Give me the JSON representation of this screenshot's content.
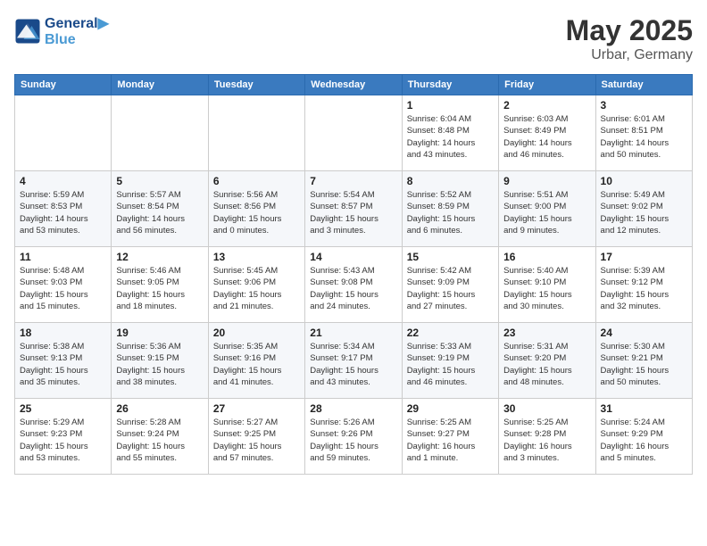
{
  "header": {
    "logo_line1": "General",
    "logo_line2": "Blue",
    "month": "May 2025",
    "location": "Urbar, Germany"
  },
  "weekdays": [
    "Sunday",
    "Monday",
    "Tuesday",
    "Wednesday",
    "Thursday",
    "Friday",
    "Saturday"
  ],
  "weeks": [
    [
      {
        "day": "",
        "info": ""
      },
      {
        "day": "",
        "info": ""
      },
      {
        "day": "",
        "info": ""
      },
      {
        "day": "",
        "info": ""
      },
      {
        "day": "1",
        "info": "Sunrise: 6:04 AM\nSunset: 8:48 PM\nDaylight: 14 hours\nand 43 minutes."
      },
      {
        "day": "2",
        "info": "Sunrise: 6:03 AM\nSunset: 8:49 PM\nDaylight: 14 hours\nand 46 minutes."
      },
      {
        "day": "3",
        "info": "Sunrise: 6:01 AM\nSunset: 8:51 PM\nDaylight: 14 hours\nand 50 minutes."
      }
    ],
    [
      {
        "day": "4",
        "info": "Sunrise: 5:59 AM\nSunset: 8:53 PM\nDaylight: 14 hours\nand 53 minutes."
      },
      {
        "day": "5",
        "info": "Sunrise: 5:57 AM\nSunset: 8:54 PM\nDaylight: 14 hours\nand 56 minutes."
      },
      {
        "day": "6",
        "info": "Sunrise: 5:56 AM\nSunset: 8:56 PM\nDaylight: 15 hours\nand 0 minutes."
      },
      {
        "day": "7",
        "info": "Sunrise: 5:54 AM\nSunset: 8:57 PM\nDaylight: 15 hours\nand 3 minutes."
      },
      {
        "day": "8",
        "info": "Sunrise: 5:52 AM\nSunset: 8:59 PM\nDaylight: 15 hours\nand 6 minutes."
      },
      {
        "day": "9",
        "info": "Sunrise: 5:51 AM\nSunset: 9:00 PM\nDaylight: 15 hours\nand 9 minutes."
      },
      {
        "day": "10",
        "info": "Sunrise: 5:49 AM\nSunset: 9:02 PM\nDaylight: 15 hours\nand 12 minutes."
      }
    ],
    [
      {
        "day": "11",
        "info": "Sunrise: 5:48 AM\nSunset: 9:03 PM\nDaylight: 15 hours\nand 15 minutes."
      },
      {
        "day": "12",
        "info": "Sunrise: 5:46 AM\nSunset: 9:05 PM\nDaylight: 15 hours\nand 18 minutes."
      },
      {
        "day": "13",
        "info": "Sunrise: 5:45 AM\nSunset: 9:06 PM\nDaylight: 15 hours\nand 21 minutes."
      },
      {
        "day": "14",
        "info": "Sunrise: 5:43 AM\nSunset: 9:08 PM\nDaylight: 15 hours\nand 24 minutes."
      },
      {
        "day": "15",
        "info": "Sunrise: 5:42 AM\nSunset: 9:09 PM\nDaylight: 15 hours\nand 27 minutes."
      },
      {
        "day": "16",
        "info": "Sunrise: 5:40 AM\nSunset: 9:10 PM\nDaylight: 15 hours\nand 30 minutes."
      },
      {
        "day": "17",
        "info": "Sunrise: 5:39 AM\nSunset: 9:12 PM\nDaylight: 15 hours\nand 32 minutes."
      }
    ],
    [
      {
        "day": "18",
        "info": "Sunrise: 5:38 AM\nSunset: 9:13 PM\nDaylight: 15 hours\nand 35 minutes."
      },
      {
        "day": "19",
        "info": "Sunrise: 5:36 AM\nSunset: 9:15 PM\nDaylight: 15 hours\nand 38 minutes."
      },
      {
        "day": "20",
        "info": "Sunrise: 5:35 AM\nSunset: 9:16 PM\nDaylight: 15 hours\nand 41 minutes."
      },
      {
        "day": "21",
        "info": "Sunrise: 5:34 AM\nSunset: 9:17 PM\nDaylight: 15 hours\nand 43 minutes."
      },
      {
        "day": "22",
        "info": "Sunrise: 5:33 AM\nSunset: 9:19 PM\nDaylight: 15 hours\nand 46 minutes."
      },
      {
        "day": "23",
        "info": "Sunrise: 5:31 AM\nSunset: 9:20 PM\nDaylight: 15 hours\nand 48 minutes."
      },
      {
        "day": "24",
        "info": "Sunrise: 5:30 AM\nSunset: 9:21 PM\nDaylight: 15 hours\nand 50 minutes."
      }
    ],
    [
      {
        "day": "25",
        "info": "Sunrise: 5:29 AM\nSunset: 9:23 PM\nDaylight: 15 hours\nand 53 minutes."
      },
      {
        "day": "26",
        "info": "Sunrise: 5:28 AM\nSunset: 9:24 PM\nDaylight: 15 hours\nand 55 minutes."
      },
      {
        "day": "27",
        "info": "Sunrise: 5:27 AM\nSunset: 9:25 PM\nDaylight: 15 hours\nand 57 minutes."
      },
      {
        "day": "28",
        "info": "Sunrise: 5:26 AM\nSunset: 9:26 PM\nDaylight: 15 hours\nand 59 minutes."
      },
      {
        "day": "29",
        "info": "Sunrise: 5:25 AM\nSunset: 9:27 PM\nDaylight: 16 hours\nand 1 minute."
      },
      {
        "day": "30",
        "info": "Sunrise: 5:25 AM\nSunset: 9:28 PM\nDaylight: 16 hours\nand 3 minutes."
      },
      {
        "day": "31",
        "info": "Sunrise: 5:24 AM\nSunset: 9:29 PM\nDaylight: 16 hours\nand 5 minutes."
      }
    ]
  ]
}
